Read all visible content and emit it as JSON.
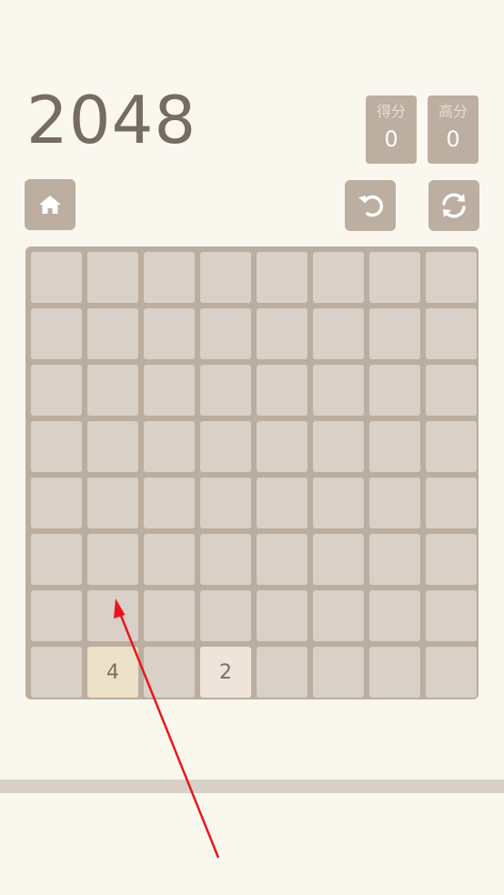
{
  "game": {
    "title": "2048"
  },
  "scores": {
    "score_label": "得分",
    "score_value": "0",
    "best_label": "高分",
    "best_value": "0"
  },
  "controls": {
    "home_icon": "home-icon",
    "undo_icon": "undo-icon",
    "restart_icon": "restart-icon"
  },
  "board": {
    "size": 8,
    "rows": [
      [
        "",
        "",
        "",
        "",
        "",
        "",
        "",
        ""
      ],
      [
        "",
        "",
        "",
        "",
        "",
        "",
        "",
        ""
      ],
      [
        "",
        "",
        "",
        "",
        "",
        "",
        "",
        ""
      ],
      [
        "",
        "",
        "",
        "",
        "",
        "",
        "",
        ""
      ],
      [
        "",
        "",
        "",
        "",
        "",
        "",
        "",
        ""
      ],
      [
        "",
        "",
        "",
        "",
        "",
        "",
        "",
        ""
      ],
      [
        "",
        "",
        "",
        "",
        "",
        "",
        "",
        ""
      ],
      [
        "",
        "4",
        "",
        "2",
        "",
        "",
        "",
        ""
      ]
    ]
  },
  "colors": {
    "background": "#faf7ef",
    "board": "#bbada0",
    "empty_cell": "#d9d0c7",
    "tile_2": "#eee4da",
    "tile_4": "#ede0c8",
    "text": "#776e65",
    "annotation_arrow": "#e8161b"
  }
}
